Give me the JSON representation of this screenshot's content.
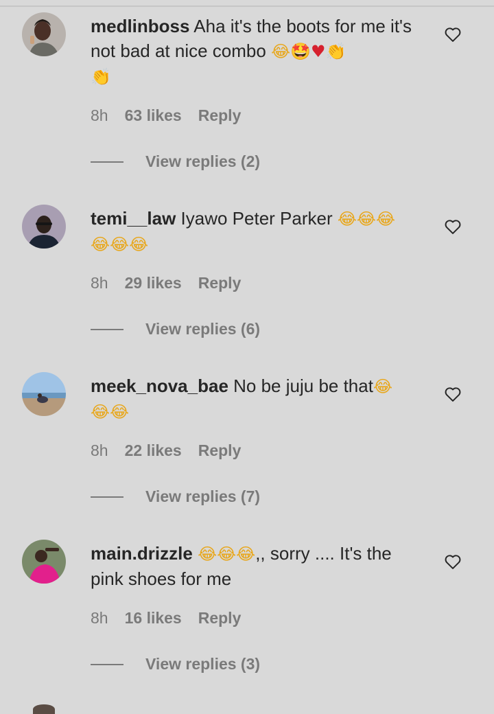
{
  "comments": [
    {
      "username": "medlinboss",
      "text": "Aha it's the boots for me it's not bad at nice combo",
      "emojis": [
        "😂",
        "🤩",
        "♥",
        "👏",
        "👏"
      ],
      "time": "8h",
      "likes": "63 likes",
      "reply": "Reply",
      "view_replies": "View replies (2)"
    },
    {
      "username": "temi__law",
      "text": "Iyawo Peter Parker",
      "emojis": [
        "😂",
        "😂",
        "😂",
        "😂",
        "😂",
        "😂"
      ],
      "time": "8h",
      "likes": "29 likes",
      "reply": "Reply",
      "view_replies": "View replies (6)"
    },
    {
      "username": "meek_nova_bae",
      "text": "No be juju be that",
      "emojis": [
        "😂",
        "😂",
        "😂"
      ],
      "time": "8h",
      "likes": "22 likes",
      "reply": "Reply",
      "view_replies": "View replies (7)"
    },
    {
      "username": "main.drizzle",
      "text_before": "",
      "emojis": [
        "😂",
        "😂",
        "😂"
      ],
      "text": ",, sorry .... It's the pink shoes for me",
      "time": "8h",
      "likes": "16 likes",
      "reply": "Reply",
      "view_replies": "View replies (3)"
    }
  ],
  "colors": {
    "background": "#d9d9d9",
    "text_primary": "#262626",
    "text_secondary": "#7a7a7a"
  },
  "icons": {
    "like": "heart-outline-icon"
  }
}
